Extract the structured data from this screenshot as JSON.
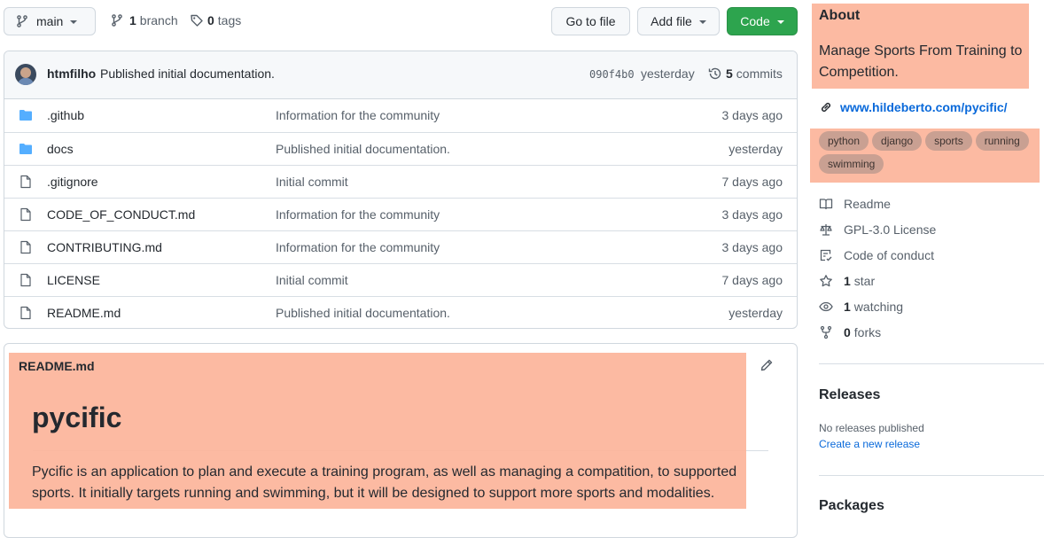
{
  "toolbar": {
    "branch_name": "main",
    "branch_count": "1",
    "branch_label": "branch",
    "tag_count": "0",
    "tag_label": "tags",
    "go_to_file": "Go to file",
    "add_file": "Add file",
    "code": "Code"
  },
  "commit": {
    "author": "htmfilho",
    "message": "Published initial documentation.",
    "sha": "090f4b0",
    "when": "yesterday",
    "commits_count": "5",
    "commits_label": "commits"
  },
  "files": [
    {
      "type": "folder",
      "name": ".github",
      "message": "Information for the community",
      "age": "3 days ago"
    },
    {
      "type": "folder",
      "name": "docs",
      "message": "Published initial documentation.",
      "age": "yesterday"
    },
    {
      "type": "file",
      "name": ".gitignore",
      "message": "Initial commit",
      "age": "7 days ago"
    },
    {
      "type": "file",
      "name": "CODE_OF_CONDUCT.md",
      "message": "Information for the community",
      "age": "3 days ago"
    },
    {
      "type": "file",
      "name": "CONTRIBUTING.md",
      "message": "Information for the community",
      "age": "3 days ago"
    },
    {
      "type": "file",
      "name": "LICENSE",
      "message": "Initial commit",
      "age": "7 days ago"
    },
    {
      "type": "file",
      "name": "README.md",
      "message": "Published initial documentation.",
      "age": "yesterday"
    }
  ],
  "readme": {
    "filename": "README.md",
    "title": "pycific",
    "body": "Pycific is an application to plan and execute a training program, as well as managing a compatition, to supported sports. It initially targets running and swimming, but it will be designed to support more sports and modalities."
  },
  "about": {
    "heading": "About",
    "description": "Manage Sports From Training to Competition.",
    "website": "www.hildeberto.com/pycific/",
    "topics": [
      "python",
      "django",
      "sports",
      "running",
      "swimming"
    ],
    "readme": "Readme",
    "license": "GPL-3.0 License",
    "conduct": "Code of conduct",
    "stars_count": "1",
    "stars_label": "star",
    "watching_count": "1",
    "watching_label": "watching",
    "forks_count": "0",
    "forks_label": "forks"
  },
  "releases": {
    "heading": "Releases",
    "none": "No releases published",
    "create": "Create a new release"
  },
  "packages": {
    "heading": "Packages"
  },
  "colors": {
    "highlight": "#fcb49a",
    "code_button": "#2da44e",
    "link": "#0969da",
    "folder": "#54aeff"
  }
}
